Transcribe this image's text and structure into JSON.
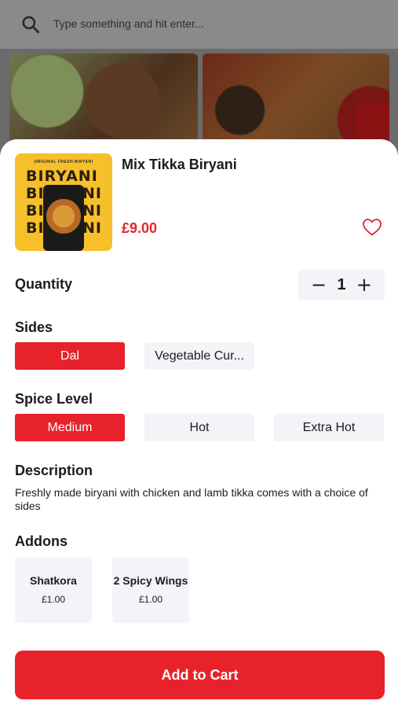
{
  "search": {
    "placeholder": "Type something and hit enter..."
  },
  "product": {
    "name": "Mix Tikka Biryani",
    "price": "£9.00",
    "image_tag": "ORIGINAL FRESH BIRYANI",
    "image_words": [
      "BIRYANI",
      "BI",
      "NI",
      "BI",
      "NI",
      "BI",
      "NI"
    ]
  },
  "quantity": {
    "label": "Quantity",
    "value": "1",
    "minus": "−",
    "plus": "+"
  },
  "sides": {
    "label": "Sides",
    "options": [
      "Dal",
      "Vegetable Cur..."
    ],
    "selected": "Dal"
  },
  "spice": {
    "label": "Spice Level",
    "options": [
      "Medium",
      "Hot",
      "Extra Hot"
    ],
    "selected": "Medium"
  },
  "description": {
    "label": "Description",
    "text": "Freshly made biryani with chicken and lamb tikka comes with a choice of sides"
  },
  "addons": {
    "label": "Addons",
    "items": [
      {
        "name": "Shatkora",
        "price": "£1.00"
      },
      {
        "name": "2 Spicy Wings",
        "price": "£1.00"
      }
    ]
  },
  "cart": {
    "label": "Add to Cart"
  },
  "colors": {
    "accent": "#e8222a",
    "price": "#e0262e",
    "chip_bg": "#f2f4f7"
  }
}
